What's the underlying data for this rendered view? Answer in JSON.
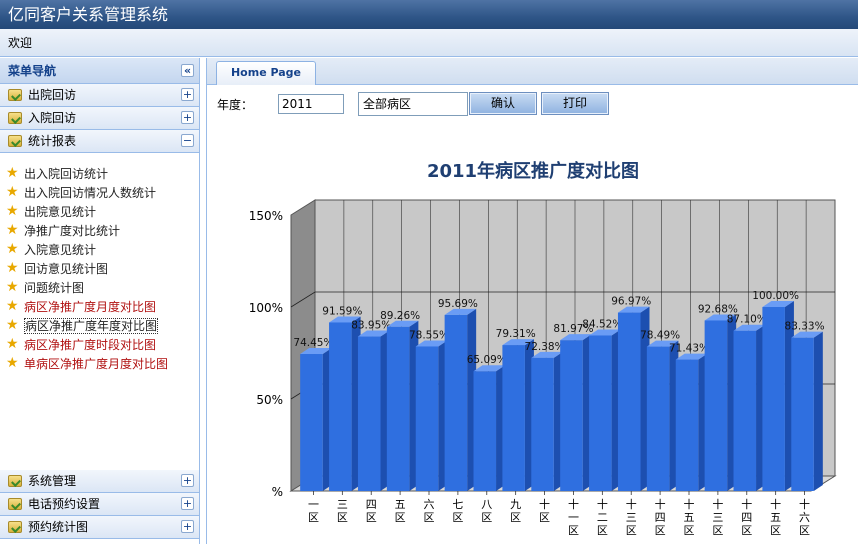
{
  "app": {
    "title": "亿同客户关系管理系统"
  },
  "menubar": {
    "welcome": "欢迎"
  },
  "sidebar": {
    "title": "菜单导航",
    "sections_top": [
      {
        "label": "出院回访",
        "toggle": "+"
      },
      {
        "label": "入院回访",
        "toggle": "+"
      },
      {
        "label": "统计报表",
        "toggle": "−"
      }
    ],
    "reports": [
      {
        "label": "出入院回访统计",
        "red": false
      },
      {
        "label": "出入院回访情况人数统计",
        "red": false
      },
      {
        "label": "出院意见统计",
        "red": false
      },
      {
        "label": "净推广度对比统计",
        "red": false
      },
      {
        "label": "入院意见统计",
        "red": false
      },
      {
        "label": "回访意见统计图",
        "red": false
      },
      {
        "label": "问题统计图",
        "red": false
      },
      {
        "label": "病区净推广度月度对比图",
        "red": true
      },
      {
        "label": "病区净推广度年度对比图",
        "red": false,
        "selected": true
      },
      {
        "label": "病区净推广度时段对比图",
        "red": true
      },
      {
        "label": "单病区净推广度月度对比图",
        "red": true
      }
    ],
    "sections_bottom": [
      {
        "label": "系统管理",
        "toggle": "+"
      },
      {
        "label": "电话预约设置",
        "toggle": "+"
      },
      {
        "label": "预约统计图",
        "toggle": "+"
      }
    ],
    "collapse_glyph": "«"
  },
  "tabs": [
    {
      "label": "Home Page"
    }
  ],
  "toolbar": {
    "year_label": "年度：",
    "year_value": "2011",
    "ward_value": "全部病区",
    "confirm_label": "确认",
    "print_label": "打印"
  },
  "chart_data": {
    "type": "bar",
    "title": "2011年病区推广度对比图",
    "categories": [
      "一区",
      "三区",
      "四区",
      "五区",
      "六区",
      "七区",
      "八区",
      "九区",
      "十区",
      "十一区",
      "十二区",
      "十三区",
      "十四区",
      "十五区",
      "十三区",
      "十四区",
      "十五区",
      "十六区"
    ],
    "values": [
      74.45,
      91.59,
      83.95,
      89.26,
      78.55,
      95.69,
      65.09,
      79.31,
      72.38,
      81.97,
      84.52,
      96.97,
      78.49,
      71.43,
      92.68,
      87.1,
      100.0,
      83.33
    ],
    "labels": [
      "74.45%",
      "91.59%",
      "83.95%",
      "89.26%",
      "78.55%",
      "95.69%",
      "65.09%",
      "79.31%",
      "72.38%",
      "81.97%",
      "84.52%",
      "96.97%",
      "78.49%",
      "71.43%",
      "92.68%",
      "87.10%",
      "100.00%",
      "83.33%"
    ],
    "yticks": [
      "%",
      "50%",
      "100%",
      "150%"
    ],
    "ylim": [
      0,
      150
    ],
    "bar_color": "#2f6fe0",
    "grid": true
  }
}
